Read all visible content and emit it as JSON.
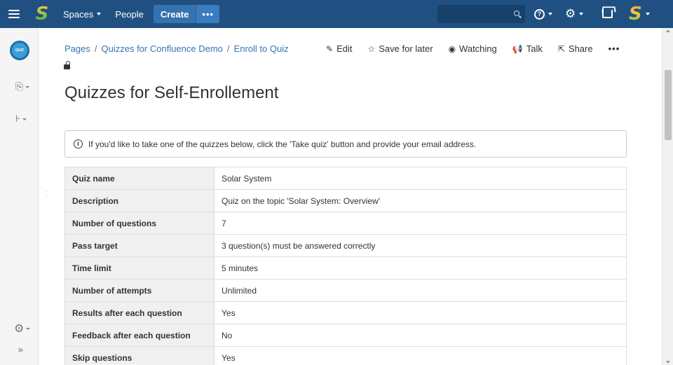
{
  "topnav": {
    "spaces_label": "Spaces",
    "people_label": "People",
    "create_label": "Create",
    "more_label": "•••",
    "help_glyph": "?"
  },
  "sidebar": {
    "space_logo_text": "QUIZ",
    "drag_handle": "⋮",
    "collapse_glyph": "»"
  },
  "breadcrumb": [
    "Pages",
    "Quizzes for Confluence Demo",
    "Enroll to Quiz"
  ],
  "breadcrumb_sep": "/",
  "actions": {
    "edit": "Edit",
    "save_for_later": "Save for later",
    "watching": "Watching",
    "talk": "Talk",
    "share": "Share",
    "more": "•••"
  },
  "page_title": "Quizzes for Self-Enrollement",
  "info": {
    "glyph": "i",
    "text": "If you'd like to take one of the quizzes below, click the 'Take quiz' button and provide your email address."
  },
  "table": {
    "rows": [
      {
        "label": "Quiz name",
        "value": "Solar System"
      },
      {
        "label": "Description",
        "value": "Quiz on the topic 'Solar System: Overview'"
      },
      {
        "label": "Number of questions",
        "value": "7"
      },
      {
        "label": "Pass target",
        "value": "3 question(s) must be answered correctly"
      },
      {
        "label": "Time limit",
        "value": "5 minutes"
      },
      {
        "label": "Number of attempts",
        "value": "Unlimited"
      },
      {
        "label": "Results after each question",
        "value": "Yes"
      },
      {
        "label": "Feedback after each question",
        "value": "No"
      },
      {
        "label": "Skip questions",
        "value": "Yes"
      }
    ]
  },
  "colors": {
    "nav_bg": "#205081",
    "create_bg": "#3572b0",
    "link": "#3b73af"
  }
}
